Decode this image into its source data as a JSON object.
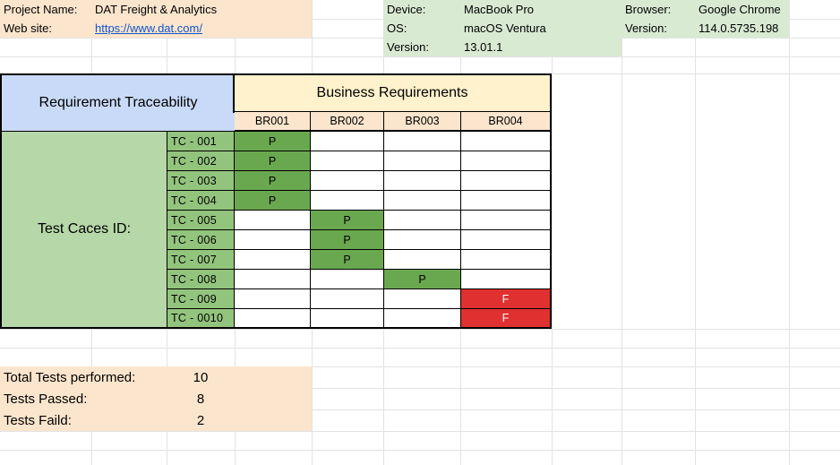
{
  "project": {
    "name_label": "Project Name:",
    "name_value": "DAT Freight & Analytics",
    "website_label": "Web site:",
    "website_value": "https://www.dat.com/"
  },
  "device": {
    "device_label": "Device:",
    "device_value": "MacBook Pro",
    "os_label": "OS:",
    "os_value": "macOS Ventura",
    "version_label": "Version:",
    "version_value": "13.01.1"
  },
  "browser": {
    "browser_label": "Browser:",
    "browser_value": "Google Chrome",
    "version_label": "Version:",
    "version_value": "114.0.5735.198"
  },
  "matrix": {
    "title": "Requirement Traceability",
    "business_header": "Business Requirements",
    "row_group_label": "Test Caces ID:",
    "requirements": [
      "BR001",
      "BR002",
      "BR003",
      "BR004"
    ],
    "rows": [
      {
        "id": "TC - 001",
        "results": [
          "P",
          "",
          "",
          ""
        ]
      },
      {
        "id": "TC - 002",
        "results": [
          "P",
          "",
          "",
          ""
        ]
      },
      {
        "id": "TC - 003",
        "results": [
          "P",
          "",
          "",
          ""
        ]
      },
      {
        "id": "TC - 004",
        "results": [
          "P",
          "",
          "",
          ""
        ]
      },
      {
        "id": "TC - 005",
        "results": [
          "",
          "P",
          "",
          ""
        ]
      },
      {
        "id": "TC - 006",
        "results": [
          "",
          "P",
          "",
          ""
        ]
      },
      {
        "id": "TC - 007",
        "results": [
          "",
          "P",
          "",
          ""
        ]
      },
      {
        "id": "TC - 008",
        "results": [
          "",
          "",
          "P",
          ""
        ]
      },
      {
        "id": "TC - 009",
        "results": [
          "",
          "",
          "",
          "F"
        ]
      },
      {
        "id": "TC - 0010",
        "results": [
          "",
          "",
          "",
          "F"
        ]
      }
    ]
  },
  "summary": {
    "total_label": "Total Tests performed:",
    "total_value": "10",
    "passed_label": "Tests Passed:",
    "passed_value": "8",
    "failed_label": "Tests Faild:",
    "failed_value": "2"
  },
  "colors": {
    "pass": "#6aa84f",
    "fail": "#e03030",
    "tc_id_bg": "#93c47d",
    "peach": "#fce5cd",
    "info_green": "#d9ead3",
    "title_blue": "#c9daf8",
    "business_yellow": "#fff2cc"
  }
}
